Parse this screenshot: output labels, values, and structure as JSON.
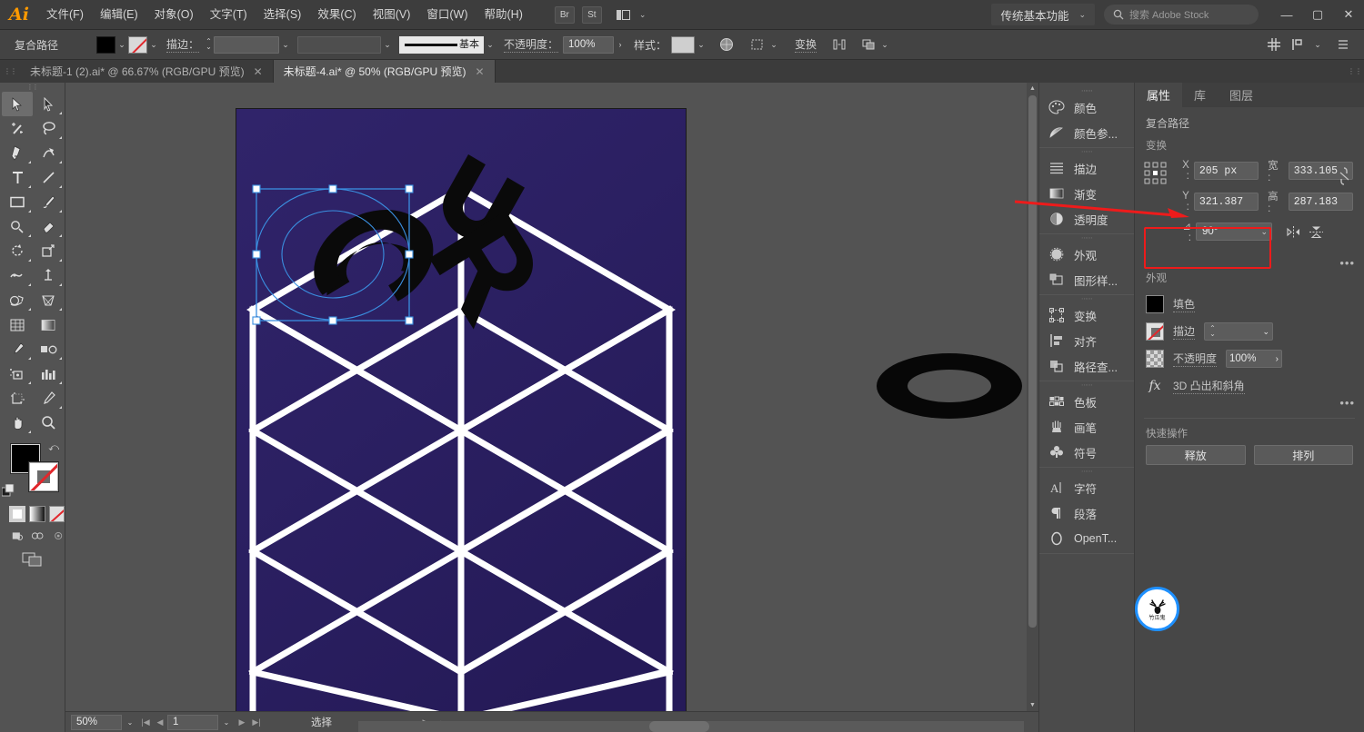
{
  "app": {
    "name": "Ai",
    "logo_text": "Ai"
  },
  "menubar": {
    "items": [
      {
        "label": "文件(F)",
        "name": "menu-file"
      },
      {
        "label": "编辑(E)",
        "name": "menu-edit"
      },
      {
        "label": "对象(O)",
        "name": "menu-object"
      },
      {
        "label": "文字(T)",
        "name": "menu-type"
      },
      {
        "label": "选择(S)",
        "name": "menu-select"
      },
      {
        "label": "效果(C)",
        "name": "menu-effect"
      },
      {
        "label": "视图(V)",
        "name": "menu-view"
      },
      {
        "label": "窗口(W)",
        "name": "menu-window"
      },
      {
        "label": "帮助(H)",
        "name": "menu-help"
      }
    ],
    "bridge_label": "Br",
    "stock_label": "St",
    "workspace": "传统基本功能",
    "search_placeholder": "搜索 Adobe Stock",
    "search_label": "搜索",
    "search_brand": "Adobe Stock",
    "window_minimize": "—",
    "window_maximize": "▢",
    "window_close": "✕"
  },
  "controlbar": {
    "object_type": "复合路径",
    "fill_color": "#000000",
    "stroke_label": "描边：",
    "stroke_weight": "",
    "stroke_profile": "",
    "brush_label": "基本",
    "opacity_label": "不透明度：",
    "opacity_value": "100%",
    "style_label": "样式：",
    "transform_label": "变换",
    "align_icon_name": "align-icon",
    "select_similar_name": "select-similar-icon",
    "arrange_name": "arrange-icon"
  },
  "tabs": [
    {
      "label": "未标题-1 (2).ai* @ 66.67% (RGB/GPU 预览)",
      "active": false
    },
    {
      "label": "未标题-4.ai* @ 50% (RGB/GPU 预览)",
      "active": true
    }
  ],
  "toolbar": {
    "tools": [
      {
        "name": "selection-tool",
        "label": "选择工具",
        "active": true
      },
      {
        "name": "direct-selection-tool",
        "label": "直接选择工具",
        "active": false
      },
      {
        "name": "magic-wand-tool",
        "label": "魔棒工具",
        "active": false
      },
      {
        "name": "lasso-tool",
        "label": "套索工具",
        "active": false
      },
      {
        "name": "pen-tool",
        "label": "钢笔工具",
        "active": false
      },
      {
        "name": "curvature-tool",
        "label": "曲率工具",
        "active": false
      },
      {
        "name": "type-tool",
        "label": "文字工具",
        "active": false
      },
      {
        "name": "line-segment-tool",
        "label": "直线段工具",
        "active": false
      },
      {
        "name": "rectangle-tool",
        "label": "矩形工具",
        "active": false
      },
      {
        "name": "paintbrush-tool",
        "label": "画笔工具",
        "active": false
      },
      {
        "name": "pencil-tool",
        "label": "铅笔工具",
        "active": false
      },
      {
        "name": "eraser-tool",
        "label": "橡皮擦工具",
        "active": false
      },
      {
        "name": "rotate-tool",
        "label": "旋转工具",
        "active": false
      },
      {
        "name": "scale-tool",
        "label": "比例缩放工具",
        "active": false
      },
      {
        "name": "width-tool",
        "label": "宽度工具",
        "active": false
      },
      {
        "name": "free-transform-tool",
        "label": "自由变换工具",
        "active": false
      },
      {
        "name": "shape-builder-tool",
        "label": "形状生成器工具",
        "active": false
      },
      {
        "name": "perspective-grid-tool",
        "label": "透视网格工具",
        "active": false
      },
      {
        "name": "mesh-tool",
        "label": "网格工具",
        "active": false
      },
      {
        "name": "gradient-tool",
        "label": "渐变工具",
        "active": false
      },
      {
        "name": "eyedropper-tool",
        "label": "吸管工具",
        "active": false
      },
      {
        "name": "blend-tool",
        "label": "混合工具",
        "active": false
      },
      {
        "name": "symbol-sprayer-tool",
        "label": "符号喷枪工具",
        "active": false
      },
      {
        "name": "column-graph-tool",
        "label": "柱形图工具",
        "active": false
      },
      {
        "name": "artboard-tool",
        "label": "画板工具",
        "active": false
      },
      {
        "name": "slice-tool",
        "label": "切片工具",
        "active": false
      },
      {
        "name": "hand-tool",
        "label": "抓手工具",
        "active": false
      },
      {
        "name": "zoom-tool",
        "label": "缩放工具",
        "active": false
      }
    ],
    "fill_color": "#000000",
    "stroke_color": "none",
    "draw_modes": [
      "正常绘图",
      "背面绘图",
      "内部绘图"
    ],
    "color_modes": [
      "solid-color",
      "gradient",
      "none"
    ]
  },
  "dock": {
    "groups": [
      {
        "items": [
          {
            "label": "颜色",
            "icon": "color-palette-icon"
          },
          {
            "label": "颜色参...",
            "icon": "color-guide-icon"
          }
        ]
      },
      {
        "items": [
          {
            "label": "描边",
            "icon": "stroke-icon"
          },
          {
            "label": "渐变",
            "icon": "gradient-icon"
          },
          {
            "label": "透明度",
            "icon": "transparency-icon"
          }
        ]
      },
      {
        "items": [
          {
            "label": "外观",
            "icon": "appearance-icon"
          },
          {
            "label": "图形样...",
            "icon": "graphic-styles-icon"
          }
        ]
      },
      {
        "items": [
          {
            "label": "变换",
            "icon": "transform-icon"
          },
          {
            "label": "对齐",
            "icon": "align-icon"
          },
          {
            "label": "路径查...",
            "icon": "pathfinder-icon"
          }
        ]
      },
      {
        "items": [
          {
            "label": "色板",
            "icon": "swatches-icon"
          },
          {
            "label": "画笔",
            "icon": "brushes-icon"
          },
          {
            "label": "符号",
            "icon": "symbols-icon"
          }
        ]
      },
      {
        "items": [
          {
            "label": "字符",
            "icon": "character-icon"
          },
          {
            "label": "段落",
            "icon": "paragraph-icon"
          },
          {
            "label": "OpenT...",
            "icon": "opentype-icon"
          }
        ]
      }
    ]
  },
  "properties": {
    "tabs": [
      {
        "label": "属性",
        "active": true
      },
      {
        "label": "库",
        "active": false
      },
      {
        "label": "图层",
        "active": false
      }
    ],
    "object_type": "复合路径",
    "transform": {
      "section_label": "变换",
      "x_label": "X :",
      "x_value": "205 px",
      "y_label": "Y :",
      "y_value": "321.387",
      "w_label": "宽 :",
      "w_value": "333.105",
      "h_label": "高 :",
      "h_value": "287.183",
      "angle_label": "⊿ :",
      "angle_value": "90°",
      "link_icon": "broken-link-icon",
      "flip_h_icon": "flip-horizontal-icon",
      "flip_v_icon": "flip-vertical-icon",
      "more_options": "•••",
      "highlight_color": "#ee1b1b"
    },
    "appearance": {
      "section_label": "外观",
      "fill_label": "填色",
      "fill_color": "#000000",
      "stroke_label": "描边",
      "stroke_value": "",
      "opacity_label": "不透明度",
      "opacity_value": "100%",
      "effect_label": "3D 凸出和斜角",
      "effect_prefix": "fx",
      "more_options": "•••"
    },
    "quick_actions": {
      "section_label": "快速操作",
      "buttons": [
        {
          "label": "释放",
          "name": "release-button"
        },
        {
          "label": "排列",
          "name": "arrange-button"
        }
      ]
    }
  },
  "statusbar": {
    "zoom_value": "50%",
    "page_value": "1",
    "status_text": "选择"
  },
  "canvas": {
    "artboard_bg": "#2b1f63",
    "grid_stroke": "#ffffff",
    "letters": [
      {
        "char": "C",
        "selected": true
      },
      {
        "char": "U",
        "selected": false
      },
      {
        "char": "R",
        "selected": false
      },
      {
        "char": "O",
        "selected": false
      }
    ],
    "selection_color": "#3a8fe0"
  },
  "badge": {
    "text": "竹瓜鬼",
    "icon": "deer-antler-icon",
    "ring_color": "#1e90ff"
  },
  "annotation": {
    "arrow_color": "#ee1b1b",
    "arrow_name": "red-pointer-arrow"
  }
}
